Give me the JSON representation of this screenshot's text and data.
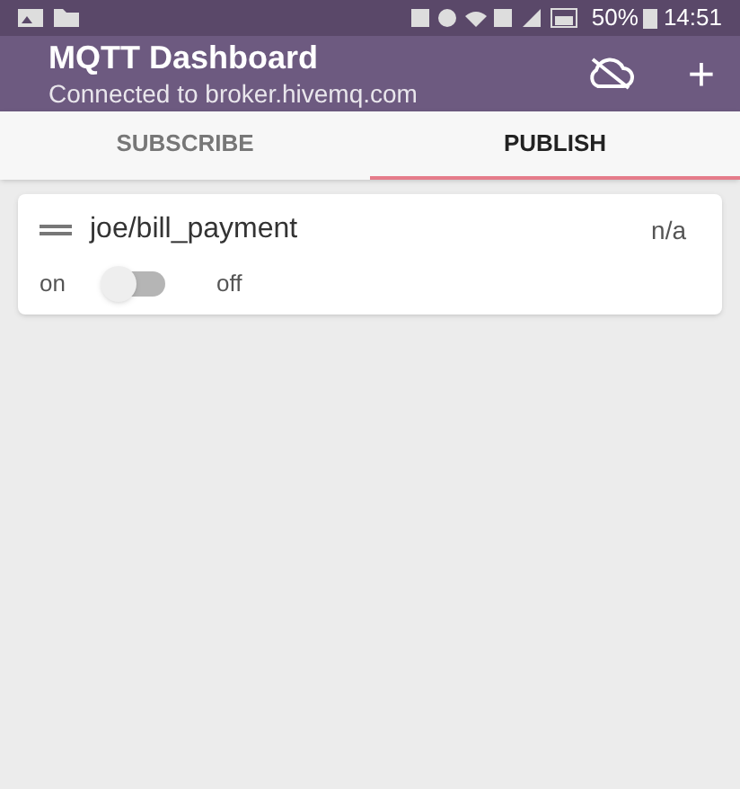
{
  "status_bar": {
    "battery": "50%",
    "time": "14:51"
  },
  "app_bar": {
    "title": "MQTT Dashboard",
    "subtitle": "Connected to broker.hivemq.com",
    "add_label": "+"
  },
  "tabs": [
    {
      "label": "SUBSCRIBE",
      "selected": false
    },
    {
      "label": "PUBLISH",
      "selected": true
    }
  ],
  "cards": [
    {
      "kind": "switch",
      "topic": "joe/bill_payment",
      "value": "n/a",
      "on_label": "on",
      "off_label": "off",
      "on": false
    }
  ]
}
